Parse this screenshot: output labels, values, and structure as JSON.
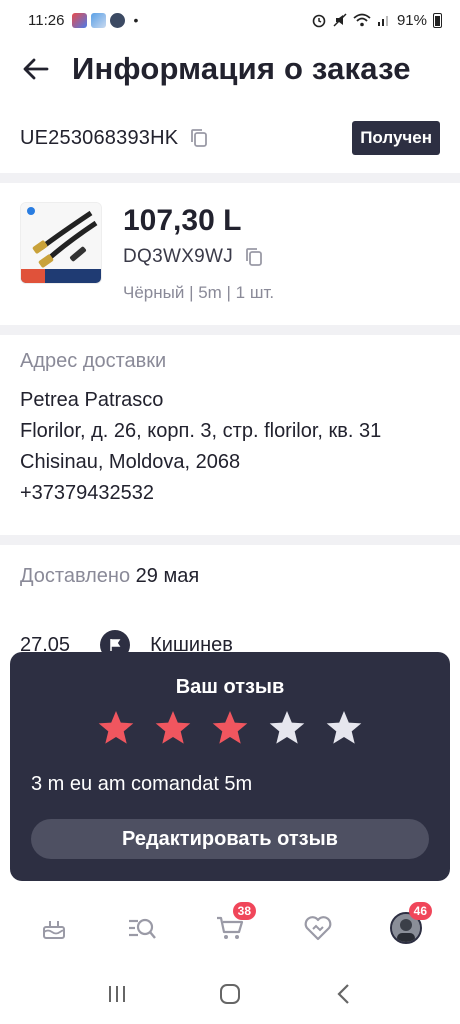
{
  "status_bar": {
    "time": "11:26",
    "dot": "•",
    "battery": "91%"
  },
  "header": {
    "title": "Информация о заказе",
    "back_icon": "arrow-left-icon"
  },
  "order": {
    "number": "UE253068393HK",
    "status": "Получен"
  },
  "product": {
    "price": "107,30 L",
    "sku": "DQ3WX9WJ",
    "variant": "Чёрный | 5m | 1 шт."
  },
  "address": {
    "label": "Адрес доставки",
    "lines": [
      "Petrea Patrasco",
      "Florilor, д. 26, корп. 3, стр. florilor, кв. 31",
      "Chisinau, Moldova, 2068",
      "+37379432532"
    ]
  },
  "delivery": {
    "label": "Доставлено",
    "date": "29 мая"
  },
  "tracking": {
    "date": "27.05",
    "city": "Кишинев"
  },
  "review": {
    "title": "Ваш отзыв",
    "rating": 3,
    "max_rating": 5,
    "text": "3 m eu am comandat 5m",
    "edit_label": "Редактировать отзыв",
    "star_filled_color": "#f0565f",
    "star_empty_color": "#e6e6ee"
  },
  "bottom_nav": {
    "items": [
      {
        "icon": "cake-icon"
      },
      {
        "icon": "search-list-icon"
      },
      {
        "icon": "cart-icon",
        "badge": "38"
      },
      {
        "icon": "heart-icon"
      },
      {
        "icon": "avatar",
        "badge": "46"
      }
    ]
  },
  "colors": {
    "accent_dark": "#2d2f42",
    "badge": "#f0465a",
    "muted_text": "#8a8a98"
  }
}
